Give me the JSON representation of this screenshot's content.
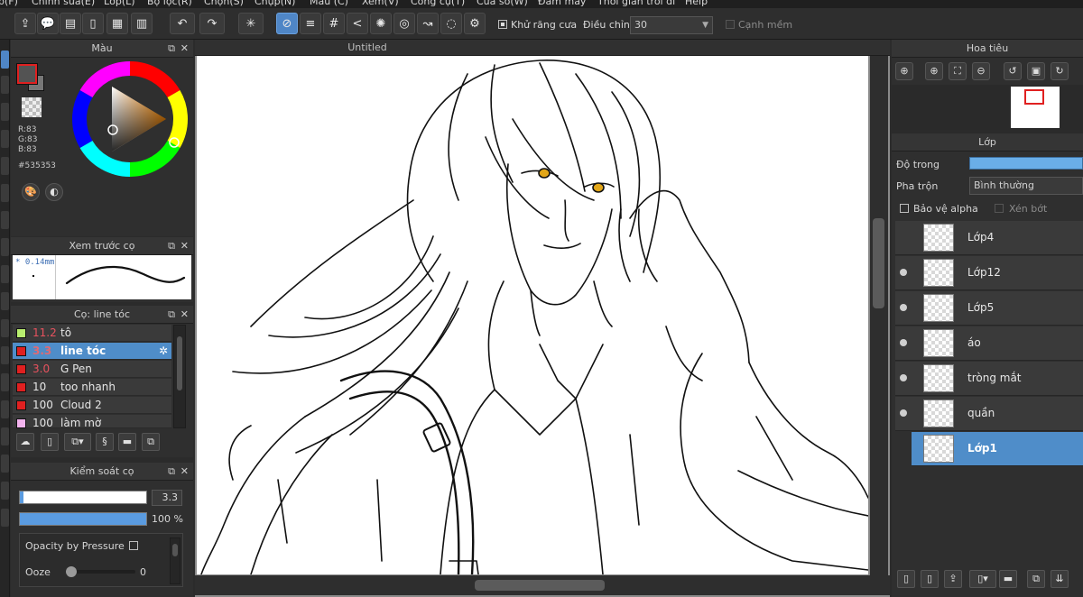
{
  "menu": [
    "p(F)",
    "Chỉnh sửa(E)",
    "Lớp(L)",
    "Bộ lọc(R)",
    "Chọn(S)",
    "Chụp(N)",
    "Màu (C)",
    "Xem(V)",
    "Công cụ(T)",
    "Cửa sổ(W)",
    "Đám mây",
    "Thời gian trôi đi",
    "Help"
  ],
  "toolbar": {
    "antialias_label": "Khử răng cưa",
    "adjust_label": "Điều chỉnh",
    "adjust_value": "30",
    "soft_edge_label": "Cạnh mềm"
  },
  "color_panel": {
    "title": "Màu",
    "r": "R:83",
    "g": "G:83",
    "b": "B:83",
    "hex": "#535353"
  },
  "brush_preview": {
    "title": "Xem trước cọ",
    "size": "* 0.14mm"
  },
  "brush_list": {
    "title": "Cọ: line tóc",
    "items": [
      {
        "size": "11.2",
        "name": "tô",
        "color": "#b9ee6f"
      },
      {
        "size": "3.3",
        "name": "line tóc",
        "color": "#e02020"
      },
      {
        "size": "3.0",
        "name": "G Pen",
        "color": "#e02020"
      },
      {
        "size": "10",
        "name": "too nhanh",
        "color": "#e02020"
      },
      {
        "size": "100",
        "name": "Cloud 2",
        "color": "#e02020"
      },
      {
        "size": "100",
        "name": "làm mờ",
        "color": "#f3b3ee"
      }
    ]
  },
  "brush_control": {
    "title": "Kiểm soát cọ",
    "size_value": "3.3",
    "opacity_value": "100 %",
    "opacity_by_pressure": "Opacity by Pressure",
    "ooze_label": "Ooze",
    "ooze_value": "0"
  },
  "canvas": {
    "title": "Untitled"
  },
  "navigator": {
    "title": "Hoa tiêu"
  },
  "layers": {
    "title": "Lớp",
    "opacity_label": "Độ trong",
    "blend_label": "Pha trộn",
    "blend_value": "Bình thường",
    "protect_alpha": "Bảo vệ alpha",
    "clip": "Xén bớt",
    "items": [
      {
        "name": "Lớp4",
        "visible": false,
        "selected": false
      },
      {
        "name": "Lớp12",
        "visible": true,
        "selected": false
      },
      {
        "name": "Lớp5",
        "visible": true,
        "selected": false
      },
      {
        "name": "áo",
        "visible": true,
        "selected": false
      },
      {
        "name": "tròng mắt",
        "visible": true,
        "selected": false
      },
      {
        "name": "quần",
        "visible": true,
        "selected": false
      },
      {
        "name": "Lớp1",
        "visible": false,
        "selected": true
      }
    ]
  }
}
